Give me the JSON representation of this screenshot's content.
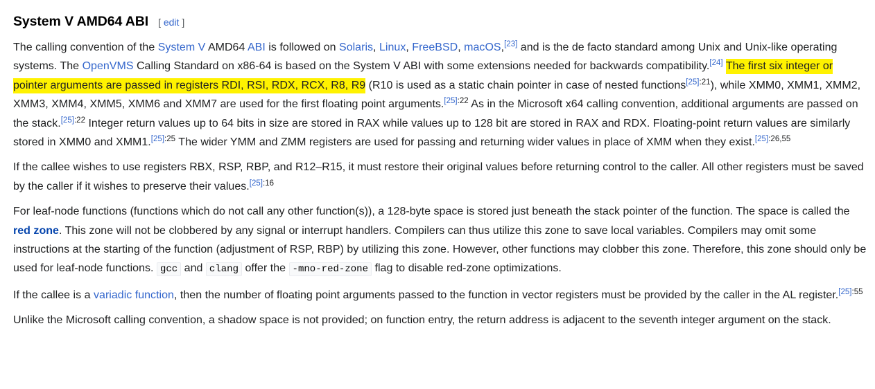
{
  "section": {
    "title": "System V AMD64 ABI",
    "edit_open": "[ ",
    "edit_label": "edit",
    "edit_close": " ]"
  },
  "p1": {
    "t1": "The calling convention of the ",
    "link_systemv": "System V",
    "t2": " AMD64 ",
    "link_abi": "ABI",
    "t3": " is followed on ",
    "link_solaris": "Solaris",
    "t4": ", ",
    "link_linux": "Linux",
    "t5": ", ",
    "link_freebsd": "FreeBSD",
    "t6": ", ",
    "link_macos": "macOS",
    "t7": ",",
    "ref23": "[23]",
    "t8": " and is the de facto standard among Unix and Unix-like operating systems. The ",
    "link_openvms": "OpenVMS",
    "t9": " Calling Standard on x86-64 is based on the System V ABI with some extensions needed for backwards compatibility.",
    "ref24": "[24]",
    "t10": " ",
    "highlight": "The first six integer or pointer arguments are passed in registers RDI, RSI, RDX, RCX, R8, R9",
    "t11": " (R10 is used as a static chain pointer in case of nested functions",
    "ref25a": "[25]",
    "pg25a": ":21",
    "t12": "), while XMM0, XMM1, XMM2, XMM3, XMM4, XMM5, XMM6 and XMM7 are used for the first floating point arguments.",
    "ref25b": "[25]",
    "pg25b": ":22",
    "t13": " As in the Microsoft x64 calling convention, additional arguments are passed on the stack.",
    "ref25c": "[25]",
    "pg25c": ":22",
    "t14": " Integer return values up to 64 bits in size are stored in RAX while values up to 128 bit are stored in RAX and RDX. Floating-point return values are similarly stored in XMM0 and XMM1.",
    "ref25d": "[25]",
    "pg25d": ":25",
    "t15": " The wider YMM and ZMM registers are used for passing and returning wider values in place of XMM when they exist.",
    "ref25e": "[25]",
    "pg25e": ":26,55"
  },
  "p2": {
    "t1": "If the callee wishes to use registers RBX, RSP, RBP, and R12–R15, it must restore their original values before returning control to the caller. All other registers must be saved by the caller if it wishes to preserve their values.",
    "ref25": "[25]",
    "pg25": ":16"
  },
  "p3": {
    "t1": "For leaf-node functions (functions which do not call any other function(s)), a 128-byte space is stored just beneath the stack pointer of the function. The space is called the ",
    "link_redzone": "red zone",
    "t2": ". This zone will not be clobbered by any signal or interrupt handlers. Compilers can thus utilize this zone to save local variables. Compilers may omit some instructions at the starting of the function (adjustment of RSP, RBP) by utilizing this zone. However, other functions may clobber this zone. Therefore, this zone should only be used for leaf-node functions. ",
    "code_gcc": "gcc",
    "t3": " and ",
    "code_clang": "clang",
    "t4": " offer the ",
    "code_flag": "-mno-red-zone",
    "t5": " flag to disable red-zone optimizations."
  },
  "p4": {
    "t1": "If the callee is a ",
    "link_variadic": "variadic function",
    "t2": ", then the number of floating point arguments passed to the function in vector registers must be provided by the caller in the AL register.",
    "ref25": "[25]",
    "pg25": ":55"
  },
  "p5": {
    "t1": "Unlike the Microsoft calling convention, a shadow space is not provided; on function entry, the return address is adjacent to the seventh integer argument on the stack."
  },
  "colors": {
    "link": "#3366cc",
    "text": "#202122",
    "highlight": "#fff200"
  }
}
